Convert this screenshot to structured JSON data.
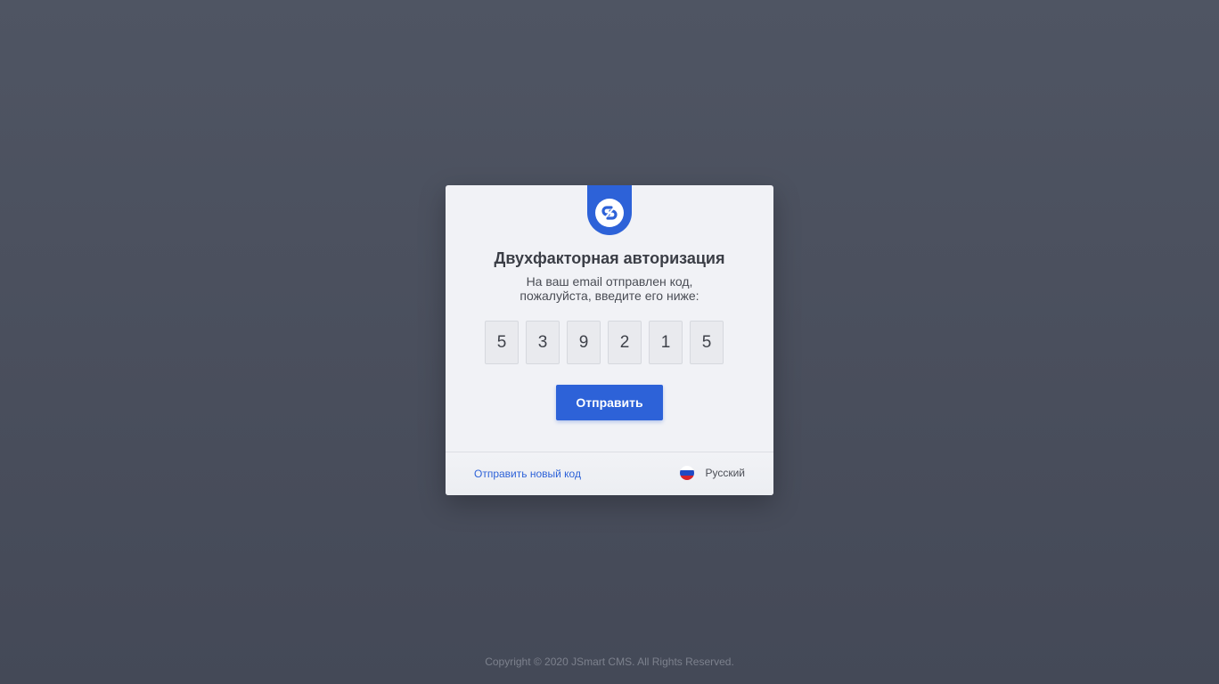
{
  "card": {
    "title": "Двухфакторная авторизация",
    "subtitle_line1": "На ваш email отправлен код,",
    "subtitle_line2": "пожалуйста, введите его ниже:",
    "code_digits": [
      "5",
      "3",
      "9",
      "2",
      "1",
      "5"
    ],
    "submit_label": "Отправить",
    "resend_label": "Отправить новый код",
    "language_label": "Русский",
    "language_flag_icon": "russia-flag-icon",
    "brand_icon": "chain-link-logo-icon"
  },
  "footer": {
    "copyright": "Copyright © 2020 JSmart CMS. All Rights Reserved."
  },
  "colors": {
    "accent": "#2d62d8",
    "background": "#4b505e",
    "card": "#f1f2f6"
  }
}
